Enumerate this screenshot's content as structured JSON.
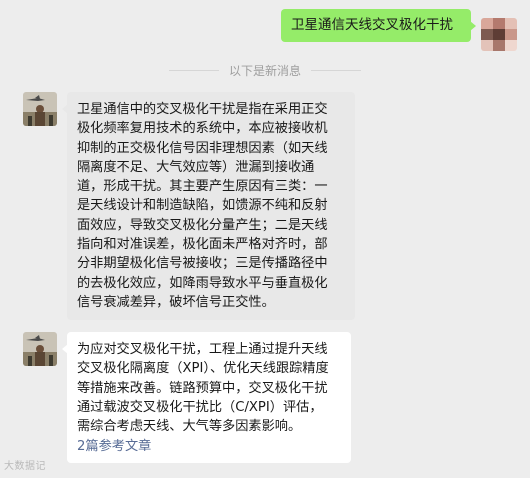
{
  "outgoing": {
    "text": "卫星通信天线交叉极化干扰"
  },
  "divider": {
    "text": "以下是新消息"
  },
  "reply1": {
    "lines": [
      "卫星通信中的交叉极化干扰是指在采用正交",
      "极化频率复用技术的系统中，本应被接收机",
      "抑制的正交极化信号因非理想因素（如天线",
      "隔离度不足、大气效应等）泄漏到接收通",
      "道，形成干扰。其主要产生原因有三类：一",
      "是天线设计和制造缺陷，如馈源不纯和反射",
      "面效应，导致交叉极化分量产生；二是天线",
      "指向和对准误差，极化面未严格对齐时，部",
      "分非期望极化信号被接收；三是传播路径中",
      "的去极化效应，如降雨导致水平与垂直极化",
      "信号衰减差异，破坏信号正交性。"
    ]
  },
  "reply2": {
    "lines": [
      "为应对交叉极化干扰，工程上通过提升天线",
      "交叉极化隔离度（XPI）、优化天线跟踪精度",
      "等措施来改善。链路预算中，交叉极化干扰",
      "通过载波交叉极化干扰比（C/XPI）评估，",
      "需综合考虑天线、大气等多因素影响。"
    ],
    "references_link": "2篇参考文章"
  },
  "watermark": "大数据记"
}
